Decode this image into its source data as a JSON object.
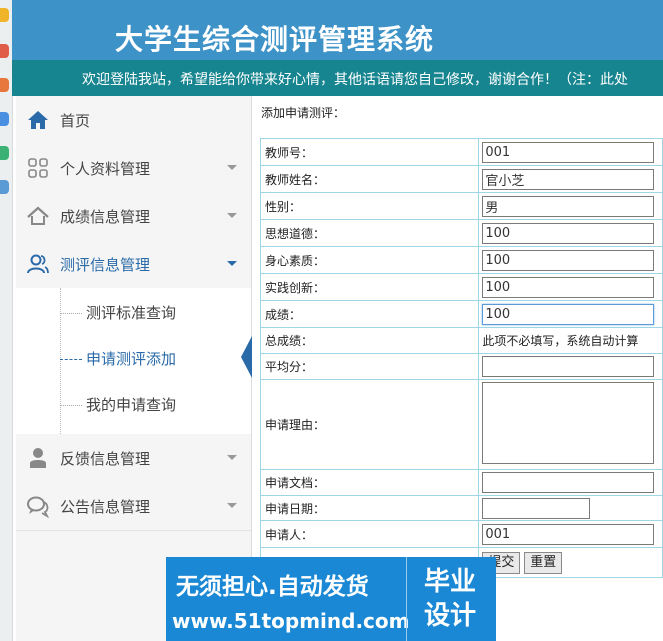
{
  "header": {
    "site_title": "大学生综合测评管理系统",
    "marquee": "欢迎登陆我站，希望能给你带来好心情，其他话语请您自己修改，谢谢合作！（注：此处"
  },
  "sidebar": {
    "items": [
      {
        "label": "首页",
        "icon": "home-icon"
      },
      {
        "label": "个人资料管理",
        "icon": "grid-icon"
      },
      {
        "label": "成绩信息管理",
        "icon": "house-outline-icon"
      },
      {
        "label": "测评信息管理",
        "icon": "users-icon"
      },
      {
        "label": "反馈信息管理",
        "icon": "person-icon"
      },
      {
        "label": "公告信息管理",
        "icon": "chat-icon"
      }
    ],
    "submenu": [
      {
        "label": "测评标准查询"
      },
      {
        "label": "申请测评添加"
      },
      {
        "label": "我的申请查询"
      }
    ]
  },
  "main": {
    "title": "添加申请测评：",
    "fields": {
      "teacher_no": {
        "label": "教师号：",
        "value": "001"
      },
      "teacher_name": {
        "label": "教师姓名：",
        "value": "官小芝"
      },
      "gender": {
        "label": "性别：",
        "value": "男"
      },
      "moral": {
        "label": "思想道德：",
        "value": "100"
      },
      "physical": {
        "label": "身心素质：",
        "value": "100"
      },
      "innovation": {
        "label": "实践创新：",
        "value": "100"
      },
      "score": {
        "label": "成绩：",
        "value": "100"
      },
      "total": {
        "label": "总成绩：",
        "hint": "此项不必填写，系统自动计算"
      },
      "average": {
        "label": "平均分：",
        "value": ""
      },
      "reason": {
        "label": "申请理由：",
        "value": ""
      },
      "document": {
        "label": "申请文档：",
        "value": ""
      },
      "date": {
        "label": "申请日期：",
        "value": ""
      },
      "applicant": {
        "label": "申请人：",
        "value": "001"
      }
    },
    "buttons": {
      "submit": "提交",
      "reset": "重置"
    }
  },
  "banner": {
    "line1": "无须担心.自动发货",
    "line2": "www.51topmind.com",
    "badge": "毕业设计"
  },
  "colors": {
    "header": "#3d92c7",
    "marquee": "#178590",
    "accent": "#2a6aa8",
    "banner": "#1a88d4"
  }
}
